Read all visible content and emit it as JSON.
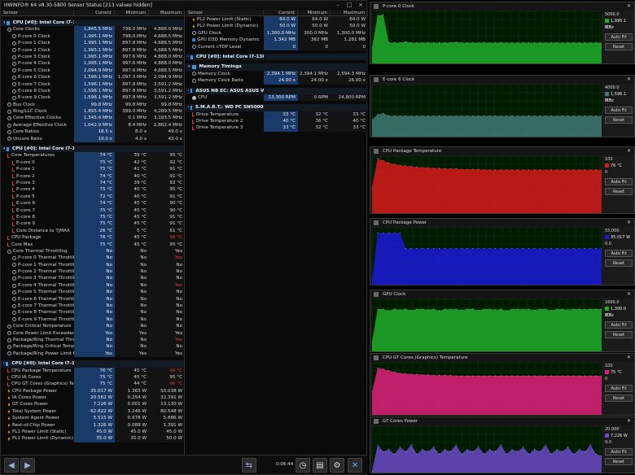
{
  "window": {
    "title": "HWiNFO® 64 v8.30-5800 Sensor Status [213 values hidden]"
  },
  "left": {
    "headers": [
      "Sensor",
      "Current",
      "Minimum",
      "Maximum"
    ],
    "rows": [
      {
        "t": "g",
        "l": "CPU [#0]: Intel Core i7-13620H"
      },
      {
        "i": "clk",
        "l": "Core Clocks",
        "c": "1,845.5 MHz",
        "mi": "798.0 MHz",
        "ma": "4,888.0 MHz",
        "d": 1
      },
      {
        "i": "clk",
        "l": "P-core 0 Clock",
        "c": "1,995.1 MHz",
        "mi": "798.0 MHz",
        "ma": "4,688.5 MHz",
        "d": 2
      },
      {
        "i": "clk",
        "l": "P-core 1 Clock",
        "c": "1,995.1 MHz",
        "mi": "897.8 MHz",
        "ma": "4,688.5 MHz",
        "d": 2
      },
      {
        "i": "clk",
        "l": "P-core 2 Clock",
        "c": "1,995.1 MHz",
        "mi": "897.8 MHz",
        "ma": "4,688.5 MHz",
        "d": 2
      },
      {
        "i": "clk",
        "l": "P-core 3 Clock",
        "c": "1,995.1 MHz",
        "mi": "997.6 MHz",
        "ma": "4,888.0 MHz",
        "d": 2
      },
      {
        "i": "clk",
        "l": "P-core 4 Clock",
        "c": "1,995.1 MHz",
        "mi": "997.6 MHz",
        "ma": "4,888.0 MHz",
        "d": 2
      },
      {
        "i": "clk",
        "l": "P-core 5 Clock",
        "c": "2,094.9 MHz",
        "mi": "997.6 MHz",
        "ma": "4,688.5 MHz",
        "d": 2
      },
      {
        "i": "clk",
        "l": "E-core 6 Clock",
        "c": "1,596.1 MHz",
        "mi": "1,097.3 MHz",
        "ma": "2,094.9 MHz",
        "d": 2
      },
      {
        "i": "clk",
        "l": "E-core 7 Clock",
        "c": "1,596.1 MHz",
        "mi": "897.8 MHz",
        "ma": "3,591.2 MHz",
        "d": 2
      },
      {
        "i": "clk",
        "l": "E-core 8 Clock",
        "c": "1,596.1 MHz",
        "mi": "897.8 MHz",
        "ma": "3,591.2 MHz",
        "d": 2
      },
      {
        "i": "clk",
        "l": "E-core 9 Clock",
        "c": "1,596.1 MHz",
        "mi": "897.8 MHz",
        "ma": "3,591.2 MHz",
        "d": 2
      },
      {
        "i": "clk",
        "l": "Bus Clock",
        "c": "99.8 MHz",
        "mi": "99.8 MHz",
        "ma": "99.8 MHz",
        "d": 1
      },
      {
        "i": "clk",
        "l": "Ring/LLC Clock",
        "c": "1,895.4 MHz",
        "mi": "399.0 MHz",
        "ma": "4,289.5 MHz",
        "d": 1
      },
      {
        "i": "clk",
        "l": "Core Effective Clocks",
        "c": "1,545.4 MHz",
        "mi": "0.1 MHz",
        "ma": "3,193.5 MHz",
        "d": 1
      },
      {
        "i": "clk",
        "l": "Average Effective Clock",
        "c": "1,642.9 MHz",
        "mi": "8.4 MHz",
        "ma": "2,862.4 MHz",
        "d": 1
      },
      {
        "i": "clk",
        "l": "Core Ratios",
        "c": "18.5 x",
        "mi": "8.0 x",
        "ma": "49.0 x",
        "d": 1
      },
      {
        "i": "clk",
        "l": "Uncore Ratio",
        "c": "19.0 x",
        "mi": "4.0 x",
        "ma": "43.0 x",
        "d": 1
      },
      {
        "t": "g",
        "l": "CPU [#0]: Intel Core i7-13620H: DTS"
      },
      {
        "i": "th",
        "l": "Core Temperatures",
        "c": "74 °C",
        "mi": "39 °C",
        "ma": "95 °C",
        "d": 1
      },
      {
        "i": "th",
        "l": "P-core 0",
        "c": "75 °C",
        "mi": "42 °C",
        "ma": "92 °C",
        "d": 2
      },
      {
        "i": "th",
        "l": "P-core 1",
        "c": "75 °C",
        "mi": "41 °C",
        "ma": "91 °C",
        "d": 2
      },
      {
        "i": "th",
        "l": "P-core 2",
        "c": "74 °C",
        "mi": "40 °C",
        "ma": "91 °C",
        "d": 2
      },
      {
        "i": "th",
        "l": "P-core 3",
        "c": "74 °C",
        "mi": "39 °C",
        "ma": "92 °C",
        "d": 2
      },
      {
        "i": "th",
        "l": "P-core 4",
        "c": "75 °C",
        "mi": "40 °C",
        "ma": "95 °C",
        "d": 2
      },
      {
        "i": "th",
        "l": "P-core 5",
        "c": "72 °C",
        "mi": "40 °C",
        "ma": "91 °C",
        "d": 2
      },
      {
        "i": "th",
        "l": "E-core 6",
        "c": "74 °C",
        "mi": "45 °C",
        "ma": "90 °C",
        "d": 2
      },
      {
        "i": "th",
        "l": "E-core 7",
        "c": "75 °C",
        "mi": "45 °C",
        "ma": "90 °C",
        "d": 2
      },
      {
        "i": "th",
        "l": "E-core 8",
        "c": "75 °C",
        "mi": "45 °C",
        "ma": "91 °C",
        "d": 2
      },
      {
        "i": "th",
        "l": "E-core 9",
        "c": "75 °C",
        "mi": "45 °C",
        "ma": "91 °C",
        "d": 2
      },
      {
        "i": "th",
        "l": "Core Distance to TjMAX",
        "c": "26 °C",
        "mi": "5 °C",
        "ma": "61 °C",
        "d": 2
      },
      {
        "i": "th",
        "l": "CPU Package",
        "c": "76 °C",
        "mi": "45 °C",
        "ma": "96 °C",
        "r": 1,
        "d": 1
      },
      {
        "i": "th",
        "l": "Core Max",
        "c": "75 °C",
        "mi": "45 °C",
        "ma": "95 °C",
        "d": 1
      },
      {
        "i": "clk",
        "l": "Core Thermal Throttling",
        "c": "No",
        "mi": "No",
        "ma": "Yes",
        "d": 1
      },
      {
        "i": "clk",
        "l": "P-core 0 Thermal Throttling",
        "c": "No",
        "mi": "No",
        "ma": "Yes",
        "r": 1,
        "d": 2
      },
      {
        "i": "clk",
        "l": "P-core 1 Thermal Throttling",
        "c": "No",
        "mi": "No",
        "ma": "No",
        "d": 2
      },
      {
        "i": "clk",
        "l": "P-core 2 Thermal Throttling",
        "c": "No",
        "mi": "No",
        "ma": "No",
        "d": 2
      },
      {
        "i": "clk",
        "l": "P-core 3 Thermal Throttling",
        "c": "No",
        "mi": "No",
        "ma": "No",
        "d": 2
      },
      {
        "i": "clk",
        "l": "P-core 4 Thermal Throttling",
        "c": "No",
        "mi": "No",
        "ma": "Yes",
        "r": 1,
        "d": 2
      },
      {
        "i": "clk",
        "l": "P-core 5 Thermal Throttling",
        "c": "No",
        "mi": "No",
        "ma": "No",
        "d": 2
      },
      {
        "i": "clk",
        "l": "E-core 6 Thermal Throttling",
        "c": "No",
        "mi": "No",
        "ma": "No",
        "d": 2
      },
      {
        "i": "clk",
        "l": "E-core 7 Thermal Throttling",
        "c": "No",
        "mi": "No",
        "ma": "No",
        "d": 2
      },
      {
        "i": "clk",
        "l": "E-core 8 Thermal Throttling",
        "c": "No",
        "mi": "No",
        "ma": "No",
        "d": 2
      },
      {
        "i": "clk",
        "l": "E-core 9 Thermal Throttling",
        "c": "No",
        "mi": "No",
        "ma": "No",
        "d": 2
      },
      {
        "i": "clk",
        "l": "Core Critical Temperature",
        "c": "No",
        "mi": "No",
        "ma": "No",
        "d": 1
      },
      {
        "i": "clk",
        "l": "Core Power Limit Exceeded",
        "c": "Yes",
        "mi": "Yes",
        "ma": "Yes",
        "d": 1
      },
      {
        "i": "clk",
        "l": "Package/Ring Thermal Throttling",
        "c": "No",
        "mi": "No",
        "ma": "Yes",
        "r": 1,
        "d": 1
      },
      {
        "i": "clk",
        "l": "Package/Ring Critical Temperature",
        "c": "No",
        "mi": "No",
        "ma": "No",
        "d": 1
      },
      {
        "i": "clk",
        "l": "Package/Ring Power Limit Exce...",
        "c": "Yes",
        "mi": "Yes",
        "ma": "Yes",
        "d": 1
      },
      {
        "t": "g",
        "l": "CPU [#0]: Intel Core i7-13620H: Enhanced"
      },
      {
        "i": "th",
        "l": "CPU Package Temperature",
        "c": "76 °C",
        "mi": "45 °C",
        "ma": "96 °C",
        "r": 1,
        "d": 1
      },
      {
        "i": "th",
        "l": "CPU IA Cores",
        "c": "75 °C",
        "mi": "45 °C",
        "ma": "95 °C",
        "d": 1
      },
      {
        "i": "th",
        "l": "CPU GT Cores (Graphics) Temper...",
        "c": "75 °C",
        "mi": "44 °C",
        "ma": "96 °C",
        "r": 1,
        "d": 1
      },
      {
        "i": "bolt",
        "l": "CPU Package Power",
        "c": "35.017 W",
        "mi": "1.363 W",
        "ma": "50.038 W",
        "d": 1
      },
      {
        "i": "bolt",
        "l": "IA Cores Power",
        "c": "20.562 W",
        "mi": "0.254 W",
        "ma": "32.391 W",
        "d": 1
      },
      {
        "i": "bolt",
        "l": "GT Cores Power",
        "c": "7.226 W",
        "mi": "0.001 W",
        "ma": "13.130 W",
        "d": 1
      },
      {
        "i": "bolt",
        "l": "Total System Power",
        "c": "62.822 W",
        "mi": "3.246 W",
        "ma": "80.548 W",
        "d": 1
      },
      {
        "i": "bolt",
        "l": "System Agent Power",
        "c": "5.515 W",
        "mi": "0.978 W",
        "ma": "5.886 W",
        "d": 1
      },
      {
        "i": "bolt",
        "l": "Rest-of-Chip Power",
        "c": "1.326 W",
        "mi": "0.088 W",
        "ma": "1.391 W",
        "d": 1
      },
      {
        "i": "bolt",
        "l": "PL1 Power Limit (Static)",
        "c": "45.0 W",
        "mi": "45.0 W",
        "ma": "45.0 W",
        "d": 1
      },
      {
        "i": "bolt",
        "l": "PL1 Power Limit (Dynamic)",
        "c": "35.0 W",
        "mi": "35.0 W",
        "ma": "50.0 W",
        "d": 1
      }
    ]
  },
  "right": {
    "headers": [
      "Sensor",
      "Current",
      "Minimum",
      "Maximum"
    ],
    "rows": [
      {
        "i": "bolt",
        "l": "PL2 Power Limit (Static)",
        "c": "64.0 W",
        "mi": "64.0 W",
        "ma": "64.0 W",
        "d": 1
      },
      {
        "i": "bolt",
        "l": "PL2 Power Limit (Dynamic)",
        "c": "50.0 W",
        "mi": "50.0 W",
        "ma": "50.0 W",
        "d": 1
      },
      {
        "i": "clk",
        "l": "GPU Clock",
        "c": "1,300.0 MHz",
        "mi": "300.0 MHz",
        "ma": "1,300.0 MHz",
        "d": 1
      },
      {
        "i": "chip",
        "l": "GPU D3D Memory Dynamic",
        "c": "1,342 MB",
        "mi": "362 MB",
        "ma": "1,281 MB",
        "d": 1
      },
      {
        "i": "clk",
        "l": "Current cTDP Level",
        "c": "0",
        "mi": "0",
        "ma": "0",
        "d": 1
      },
      {
        "t": "g",
        "l": "CPU [#0]: Intel Core i7-13620H: C-State Residency"
      },
      {
        "t": "g",
        "l": "Memory Timings"
      },
      {
        "i": "clk",
        "l": "Memory Clock",
        "c": "2,394.1 MHz",
        "mi": "2,394.1 MHz",
        "ma": "2,594.3 MHz",
        "d": 1
      },
      {
        "i": "clk",
        "l": "Memory Clock Ratio",
        "c": "24.00 x",
        "mi": "24.00 x",
        "ma": "26.00 x",
        "d": 1
      },
      {
        "t": "g",
        "l": "ASUS NB EC: ASUS ASUS Vivobook S 16 S5607VA_S5607VA"
      },
      {
        "i": "gear",
        "l": "CPU",
        "c": "13,300 RPM",
        "mi": "0 RPM",
        "ma": "24,800 RPM",
        "d": 1
      },
      {
        "t": "g",
        "l": "S.M.A.R.T.: WD PC SN5000S SDEQNSJ-512G-1002 (25030180585B) [C:]"
      },
      {
        "i": "th",
        "l": "Drive Temperature",
        "c": "33 °C",
        "mi": "32 °C",
        "ma": "33 °C",
        "d": 1
      },
      {
        "i": "th",
        "l": "Drive Temperature 2",
        "c": "40 °C",
        "mi": "36 °C",
        "ma": "40 °C",
        "d": 1
      },
      {
        "i": "th",
        "l": "Drive Temperature 3",
        "c": "33 °C",
        "mi": "32 °C",
        "ma": "33 °C",
        "d": 1
      }
    ]
  },
  "bottom": {
    "timer": "0:06:44"
  },
  "graph_labels": {
    "auto_fit": "Auto Fit",
    "reset": "Reset"
  },
  "colors": {
    "green": "#1fae2a",
    "teal": "#3f7a76",
    "red": "#d81a1a",
    "blue": "#1a1ad8",
    "magenta": "#e0207a",
    "purple": "#6a4ac8"
  },
  "chart_data": [
    {
      "type": "area",
      "title": "P-core 0 Clock",
      "max_label": "5000.0",
      "min_label": "0.0",
      "current": "1,995.1 MHz",
      "ylim": [
        0,
        5000
      ],
      "color": "#1fae2a",
      "values": [
        1500,
        4600,
        4688,
        1996,
        2000,
        1996,
        2100,
        1995,
        1996,
        1996,
        2000,
        1996,
        1995,
        1995,
        2000,
        2050,
        1995,
        1995,
        1996,
        1995,
        2000,
        1995,
        1995,
        2000,
        1995,
        1996,
        1996,
        2000,
        1995,
        1995,
        1996,
        1995,
        1996,
        2000,
        1995,
        1995,
        2000,
        1995,
        1996,
        1995,
        1995,
        2000
      ]
    },
    {
      "type": "area",
      "title": "E-core 6 Clock",
      "max_label": "4000.0",
      "min_label": "0.0",
      "current": "1,596.1 MHz",
      "ylim": [
        0,
        4000
      ],
      "color": "#3f7a76",
      "values": [
        1300,
        1700,
        1800,
        1600,
        1600,
        1596,
        1600,
        1596,
        1596,
        1600,
        1596,
        1596,
        1600,
        1596,
        1596,
        1600,
        1596,
        1600,
        1596,
        1596,
        1600,
        1596,
        1600,
        1596,
        1596,
        1600,
        1596,
        1596,
        1600,
        1596,
        1596,
        1600,
        1596,
        1596,
        1600,
        1596,
        1596,
        1600,
        1596,
        1596,
        1596,
        1596
      ]
    },
    {
      "type": "area",
      "title": "CPU Package Temperature",
      "max_label": "100",
      "min_label": "0",
      "current": "76 °C",
      "ylim": [
        0,
        100
      ],
      "color": "#d81a1a",
      "values": [
        45,
        96,
        92,
        88,
        86,
        84,
        83,
        82,
        81,
        80,
        80,
        79,
        79,
        78,
        78,
        78,
        77,
        77,
        77,
        77,
        76,
        76,
        76,
        76,
        76,
        76,
        76,
        76,
        76,
        76,
        76,
        76,
        76,
        76,
        76,
        76,
        76,
        76,
        76,
        76,
        76,
        76
      ]
    },
    {
      "type": "area",
      "title": "CPU Package Power",
      "max_label": "55.000",
      "min_label": "0.0",
      "current": "35.017 W",
      "ylim": [
        0,
        55
      ],
      "color": "#1a1ad8",
      "values": [
        3,
        50,
        50,
        50,
        50,
        50,
        35,
        35,
        35,
        35,
        35,
        35,
        35,
        35,
        35,
        35,
        35,
        35,
        35,
        35,
        35,
        35,
        35,
        35,
        35,
        35,
        35,
        35,
        35,
        35,
        35,
        35,
        35,
        35,
        35,
        35,
        35,
        35,
        35,
        35,
        35,
        35
      ]
    },
    {
      "type": "area",
      "title": "GPU Clock",
      "max_label": "1600.0",
      "min_label": "0.0",
      "current": "1,300.0 MHz",
      "ylim": [
        0,
        1600
      ],
      "color": "#1fae2a",
      "values": [
        300,
        1300,
        1300,
        1250,
        1300,
        1280,
        1300,
        1260,
        1300,
        1300,
        1280,
        1300,
        1250,
        1300,
        1290,
        1300,
        1270,
        1300,
        1300,
        1260,
        1300,
        1300,
        1280,
        1300,
        1250,
        1300,
        1300,
        1290,
        1300,
        1270,
        1300,
        1300,
        1260,
        1300,
        1300,
        1280,
        1300,
        1300,
        1290,
        1300,
        1300,
        1300
      ]
    },
    {
      "type": "area",
      "title": "CPU GT Cores (Graphics) Temperature",
      "max_label": "100",
      "min_label": "0",
      "current": "75 °C",
      "ylim": [
        0,
        100
      ],
      "color": "#e0207a",
      "values": [
        44,
        90,
        88,
        85,
        82,
        80,
        79,
        78,
        78,
        77,
        77,
        76,
        76,
        76,
        76,
        75,
        75,
        75,
        75,
        75,
        75,
        75,
        75,
        75,
        75,
        75,
        75,
        75,
        75,
        75,
        75,
        75,
        75,
        75,
        75,
        75,
        75,
        75,
        75,
        75,
        75,
        75
      ]
    },
    {
      "type": "area",
      "title": "GT Cores Power",
      "max_label": "20.000",
      "min_label": "0.0",
      "current": "7.226 W",
      "ylim": [
        0,
        20
      ],
      "color": "#6a4ac8",
      "values": [
        0.5,
        12,
        9,
        10,
        8,
        11,
        9,
        12,
        8,
        10,
        9,
        11,
        8,
        10,
        9,
        12,
        8,
        10,
        9,
        11,
        8,
        10,
        9,
        12,
        8,
        10,
        9,
        11,
        8,
        10,
        9,
        12,
        8,
        10,
        9,
        11,
        8,
        10,
        9,
        12,
        8,
        7.2
      ]
    }
  ]
}
